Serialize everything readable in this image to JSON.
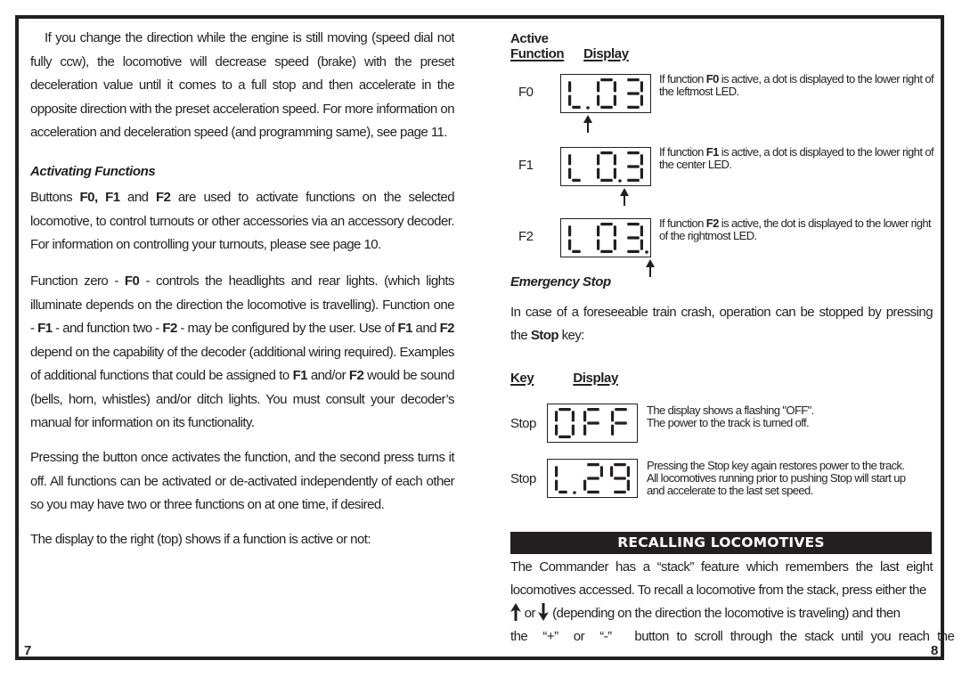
{
  "left_page": {
    "page_number": "7",
    "intro_paragraph": "If you change the direction while the engine is still moving (speed dial not fully ccw), the locomotive will decrease speed (brake) with the preset deceleration value until it comes to a full stop and then accelerate in the opposite direction with the preset acceleration speed. For more information on acceleration and deceleration speed (and programming same), see page 11.",
    "activating_functions": {
      "heading": "Activating Functions",
      "p1": {
        "t1": "Buttons ",
        "b1": "F0, F1",
        "t2": " and ",
        "b2": "F2",
        "t3": " are used to activate functions on the selected locomotive, to control turnouts or other accessories via an accessory decoder. For information on controlling your turnouts, please see page 10."
      },
      "p2": {
        "t1": "Function zero - ",
        "b1": "F0",
        "t2": " - controls the headlights and rear lights. (which lights illuminate depends on the direction the locomotive is travelling). Function one - ",
        "b2": "F1",
        "t3": " - and function two - ",
        "b3": "F2",
        "t4": " - may be configured by the user. Use of ",
        "b4": "F1",
        "t5": " and ",
        "b5": "F2",
        "t6": " depend on the capability of the decoder (additional wiring required). Examples of additional functions that could be assigned to ",
        "b6": "F1",
        "t7": " and/or ",
        "b7": "F2",
        "t8": " would be sound (bells, horn, whistles) and/or ditch lights. You must consult your decoder’s manual for information on its functionality."
      },
      "p3": "Pressing the button once activates the function, and the second press turns it off. All functions can be activated or de-activated independently of each other so you may have two or three functions on at one time, if desired.",
      "p4": "The display to the right (top) shows if a function is active or not:"
    }
  },
  "right_page": {
    "page_number": "8",
    "function_table": {
      "header_active": "Active",
      "header_function": "Function",
      "header_display": "Display",
      "rows": [
        {
          "label": "F0",
          "display": "L.03",
          "dot_after_digit": 0,
          "desc_t1": "If function ",
          "desc_b": "F0",
          "desc_t2": " is active, a dot is displayed to the lower right of the leftmost LED."
        },
        {
          "label": "F1",
          "display": "L0.3",
          "dot_after_digit": 1,
          "desc_t1": "If function ",
          "desc_b": "F1",
          "desc_t2": " is active, a dot is displayed to the lower right of the center LED."
        },
        {
          "label": "F2",
          "display": "L03.",
          "dot_after_digit": 2,
          "desc_t1": "If function ",
          "desc_b": "F2",
          "desc_t2": " is active, the dot is displayed to the lower right of the rightmost LED."
        }
      ]
    },
    "emergency_stop": {
      "heading": "Emergency Stop",
      "intro_t1": "In case of a foreseeable train crash, operation can be stopped by pressing the ",
      "intro_b": "Stop",
      "intro_t2": " key:",
      "header_key": "Key",
      "header_display": "Display",
      "rows": [
        {
          "label": "Stop",
          "display": "OFF",
          "desc_line1": "The display shows a flashing  \"OFF\".",
          "desc_line2": "The power to the track is turned off.",
          "desc_line3": ""
        },
        {
          "label": "Stop",
          "display": "L.29",
          "desc_line1": "Pressing the Stop key again restores power to the track.",
          "desc_line2": "All locomotives running prior to pushing Stop will start up",
          "desc_line3": "and accelerate to the last set speed."
        }
      ]
    },
    "recalling": {
      "banner": "RECALLING LOCOMOTIVES",
      "p1": "The Commander has a “stack” feature which remembers the last eight locomotives accessed. To recall a locomotive from the stack, press either the",
      "line3_or": " or ",
      "line3_rest": " (depending on the direction the locomotive is traveling) and then",
      "line4": "the  “+”  or  “-”   button to scroll through the stack until you reach the"
    }
  },
  "colors": {
    "ink": "#231f20",
    "paper": "#ffffff"
  }
}
